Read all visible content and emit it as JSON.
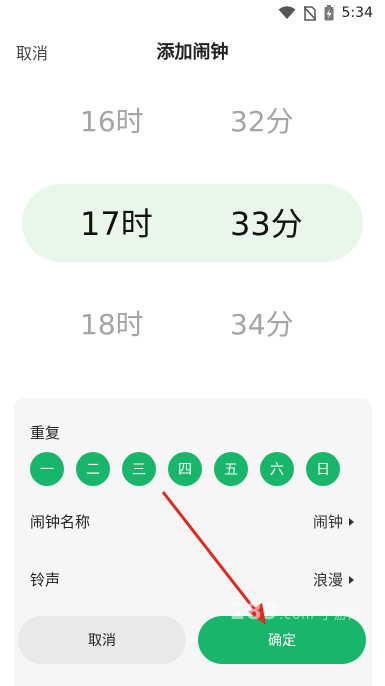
{
  "status_bar": {
    "time": "5:34"
  },
  "header": {
    "cancel_label": "取消",
    "title": "添加闹钟"
  },
  "picker": {
    "rows": [
      {
        "hour": "16时",
        "minute": "32分"
      },
      {
        "hour": "17时",
        "minute": "33分"
      },
      {
        "hour": "18时",
        "minute": "34分"
      }
    ]
  },
  "repeat": {
    "label": "重复",
    "days": [
      "一",
      "二",
      "三",
      "四",
      "五",
      "六",
      "日"
    ]
  },
  "alarm_name": {
    "label": "闹钟名称",
    "value": "闹钟"
  },
  "ringtone": {
    "label": "铃声",
    "value": "浪漫"
  },
  "buttons": {
    "cancel": "取消",
    "ok": "确定"
  },
  "watermark": {
    "text": "289",
    "suffix": ".com 手游网"
  },
  "colors": {
    "accent": "#18b66a",
    "selection_band": "#e9f7ea",
    "sheet": "#f6f6f6"
  }
}
